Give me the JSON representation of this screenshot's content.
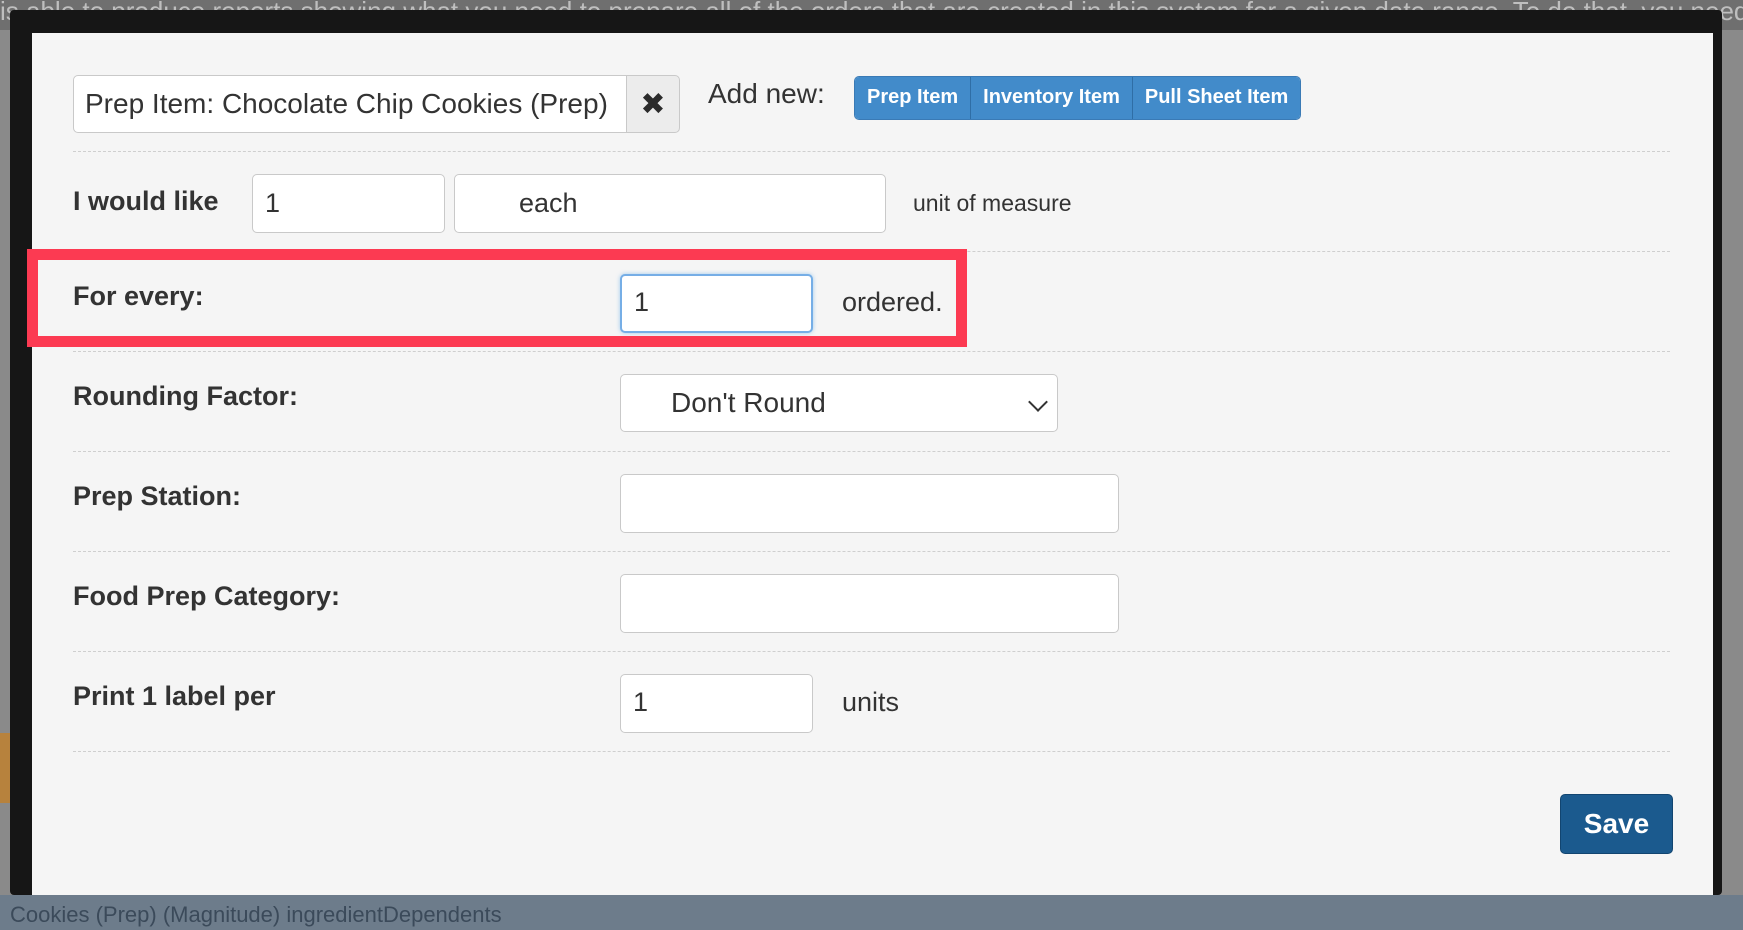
{
  "background": {
    "top_text": "is able to produce reports showing what you need to prepare all of the orders that are created in this system for a given date range. To do that, you need to tell us",
    "bottom_text": "Cookies (Prep) (Magnitude) ingredientDependents"
  },
  "modal": {
    "item_search": {
      "value": "Prep Item: Chocolate Chip Cookies (Prep)",
      "clear_glyph": "✖"
    },
    "add_new": {
      "label": "Add new:",
      "buttons": [
        "Prep Item",
        "Inventory Item",
        "Pull Sheet Item"
      ]
    },
    "would_like": {
      "label": "I would like",
      "quantity": "1",
      "unit": "each",
      "suffix": "unit of measure"
    },
    "for_every": {
      "label": "For every:",
      "value": "1",
      "suffix": "ordered."
    },
    "rounding": {
      "label": "Rounding Factor:",
      "selected": "Don't Round"
    },
    "prep_station": {
      "label": "Prep Station:",
      "value": ""
    },
    "food_prep_category": {
      "label": "Food Prep Category:",
      "value": ""
    },
    "print_label": {
      "label": "Print 1 label per",
      "value": "1",
      "suffix": "units"
    },
    "save_label": "Save"
  },
  "colors": {
    "primary_button": "#428bca",
    "save_button": "#1b5a8e",
    "highlight": "#fc3a52"
  }
}
